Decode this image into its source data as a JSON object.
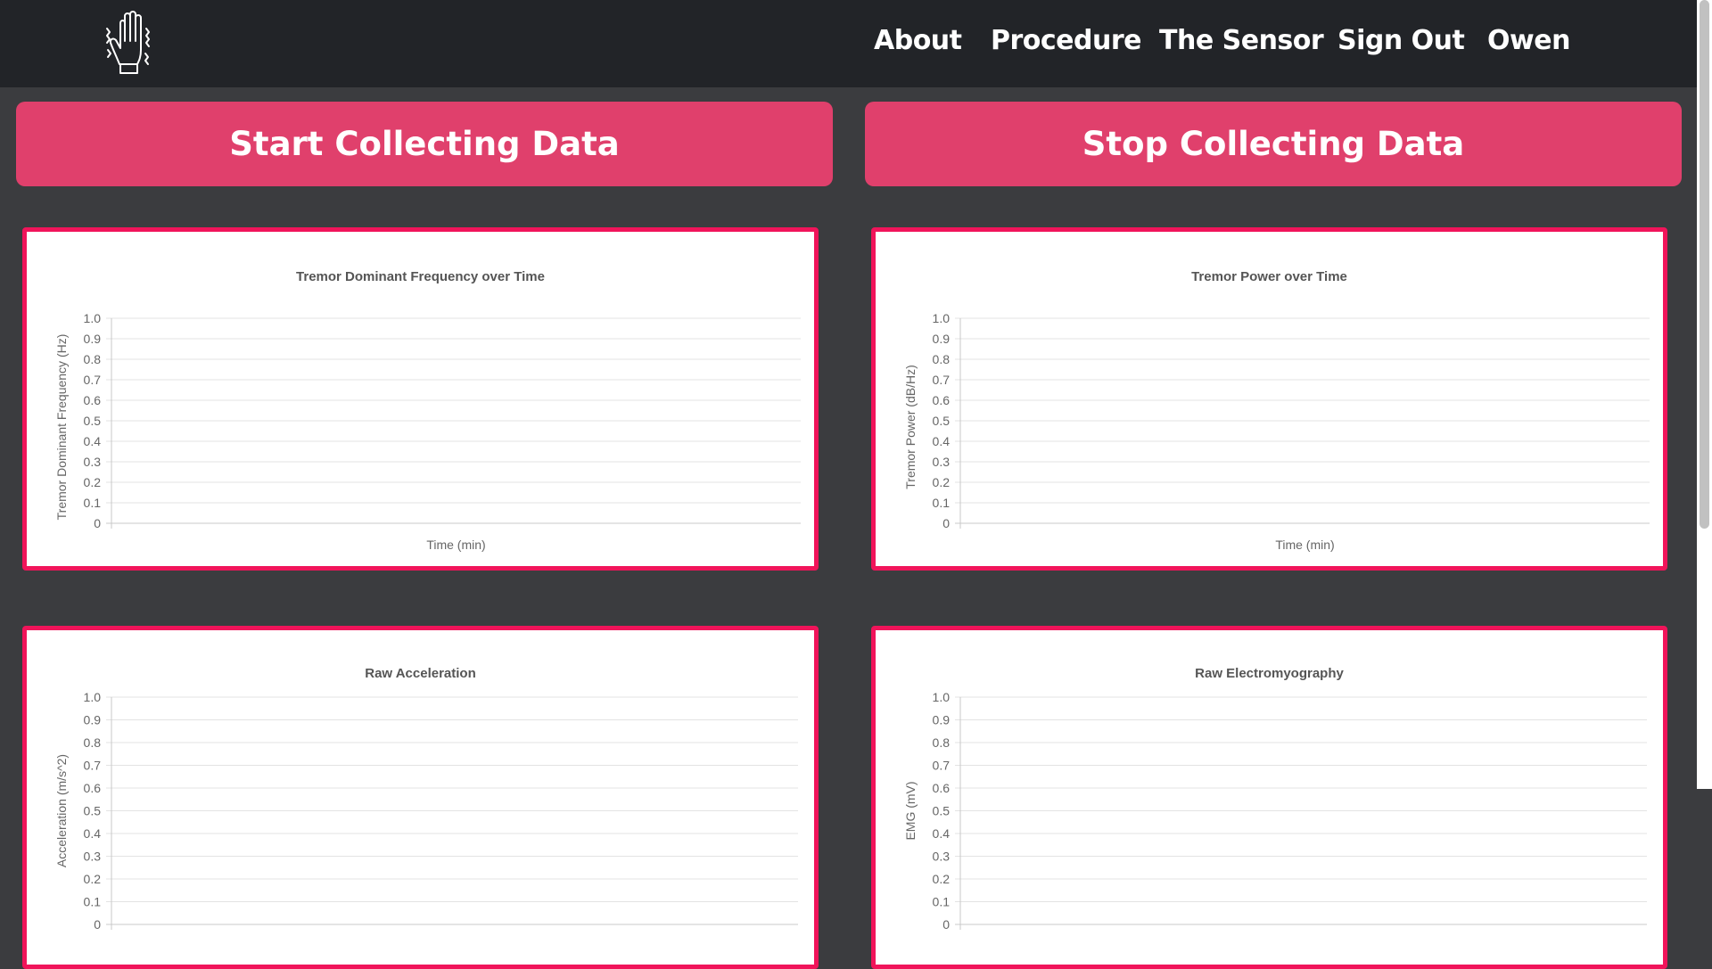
{
  "nav": {
    "logo_icon": "tremor-hand-icon",
    "links": [
      "About",
      "Procedure",
      "The Sensor",
      "Sign Out",
      "Owen"
    ]
  },
  "actions": {
    "start_label": "Start Collecting Data",
    "stop_label": "Stop Collecting Data",
    "button_color": "#e0406c"
  },
  "colors": {
    "navbar": "#222428",
    "background": "#3b3c3f",
    "card_border": "#f0145a"
  },
  "chart_data": [
    {
      "type": "line",
      "title": "Tremor Dominant Frequency over Time",
      "xlabel": "Time (min)",
      "ylabel": "Tremor Dominant Frequency (Hz)",
      "ylim": [
        0,
        1
      ],
      "yticks": [
        "1.0",
        "0.9",
        "0.8",
        "0.7",
        "0.6",
        "0.5",
        "0.4",
        "0.3",
        "0.2",
        "0.1",
        "0"
      ],
      "series": [],
      "grid": true
    },
    {
      "type": "line",
      "title": "Tremor Power over Time",
      "xlabel": "Time (min)",
      "ylabel": "Tremor Power (dB/Hz)",
      "ylim": [
        0,
        1
      ],
      "yticks": [
        "1.0",
        "0.9",
        "0.8",
        "0.7",
        "0.6",
        "0.5",
        "0.4",
        "0.3",
        "0.2",
        "0.1",
        "0"
      ],
      "series": [],
      "grid": true
    },
    {
      "type": "line",
      "title": "Raw Acceleration",
      "xlabel": "",
      "ylabel": "Acceleration (m/s^2)",
      "ylim": [
        0,
        1
      ],
      "yticks": [
        "1.0",
        "0.9",
        "0.8",
        "0.7",
        "0.6",
        "0.5",
        "0.4",
        "0.3",
        "0.2",
        "0.1",
        "0"
      ],
      "series": [],
      "grid": true
    },
    {
      "type": "line",
      "title": "Raw Electromyography",
      "xlabel": "",
      "ylabel": "EMG (mV)",
      "ylim": [
        0,
        1
      ],
      "yticks": [
        "1.0",
        "0.9",
        "0.8",
        "0.7",
        "0.6",
        "0.5",
        "0.4",
        "0.3",
        "0.2",
        "0.1",
        "0"
      ],
      "series": [],
      "grid": true
    }
  ]
}
